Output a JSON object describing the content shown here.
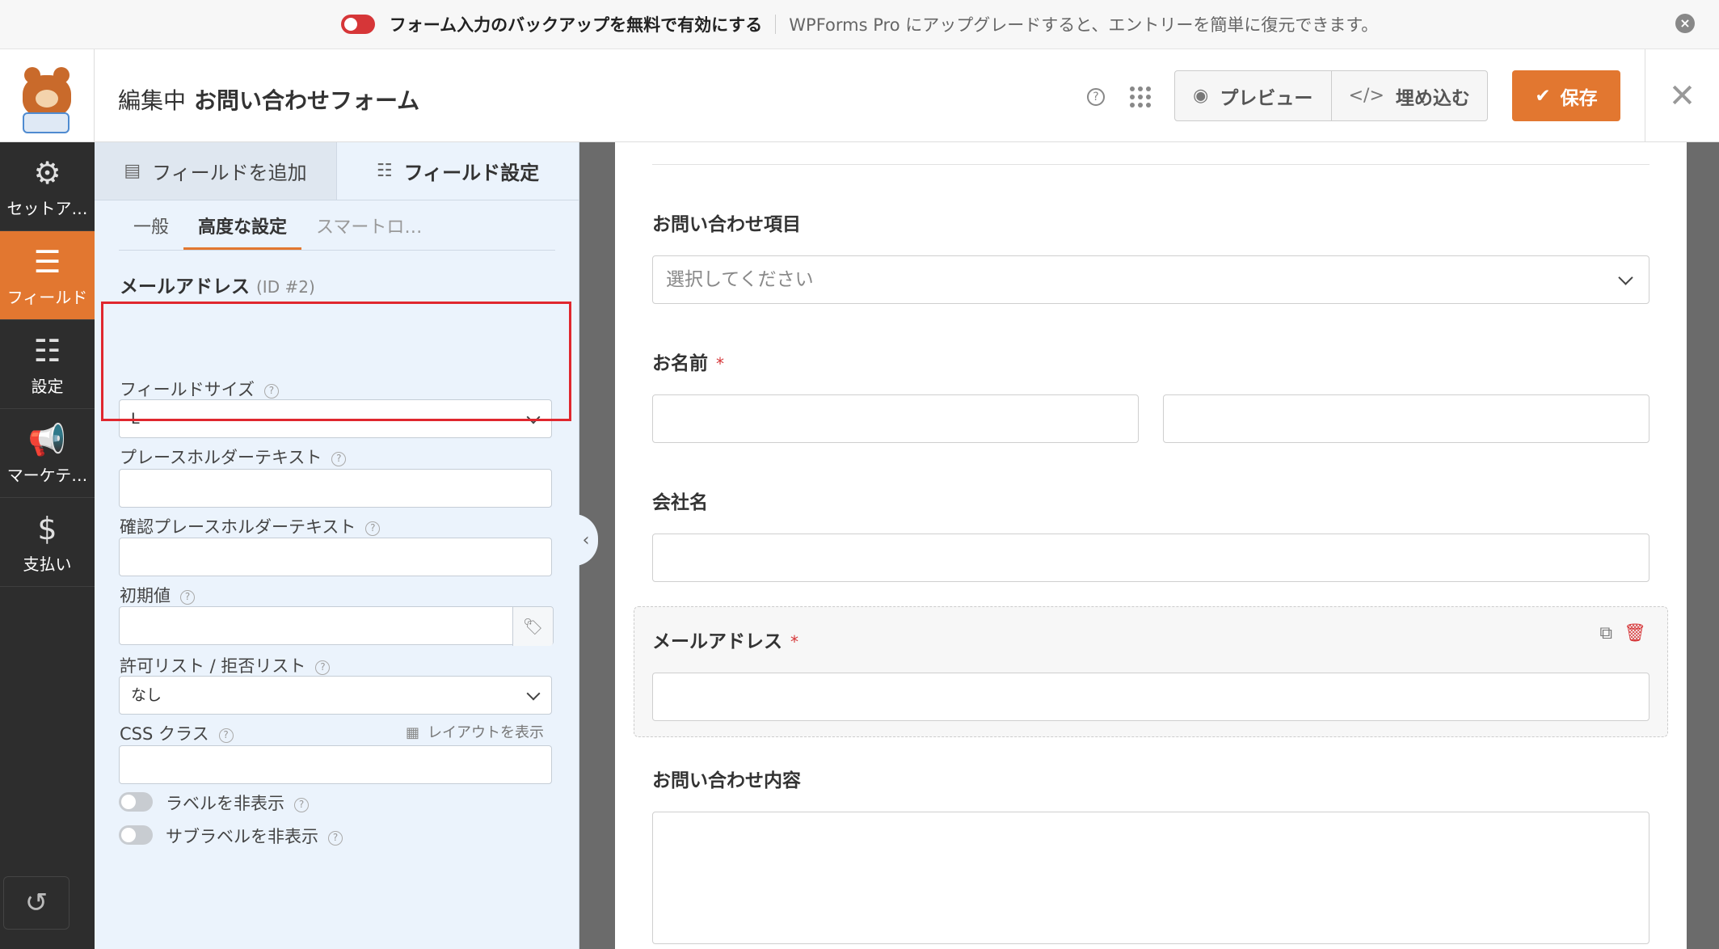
{
  "notice": {
    "main": "フォーム入力のバックアップを無料で有効にする",
    "sub": "WPForms Pro にアップグレードすると、エントリーを簡単に復元できます。"
  },
  "header": {
    "editing_label": "編集中",
    "form_name": "お問い合わせフォーム",
    "preview_label": "プレビュー",
    "embed_label": "埋め込む",
    "save_label": "保存"
  },
  "leftnav": {
    "items": [
      {
        "label": "セットア…",
        "icon": "gear-icon"
      },
      {
        "label": "フィールド",
        "icon": "fields-icon"
      },
      {
        "label": "設定",
        "icon": "sliders-icon"
      },
      {
        "label": "マーケテ…",
        "icon": "megaphone-icon"
      },
      {
        "label": "支払い",
        "icon": "dollar-icon"
      }
    ]
  },
  "panel": {
    "tabs": [
      "フィールドを追加",
      "フィールド設定"
    ],
    "subtabs": [
      "一般",
      "高度な設定",
      "スマートロ…"
    ],
    "field_name": "メールアドレス",
    "field_id": "(ID #2)",
    "field_size_label": "フィールドサイズ",
    "field_size_value": "L",
    "placeholder_label": "プレースホルダーテキスト",
    "placeholder_value": "",
    "confirm_placeholder_label": "確認プレースホルダーテキスト",
    "confirm_placeholder_value": "",
    "default_label": "初期値",
    "default_value": "",
    "allowlist_label": "許可リスト / 拒否リスト",
    "allowlist_value": "なし",
    "css_label": "CSS クラス",
    "css_value": "",
    "layout_link": "レイアウトを表示",
    "hide_label": "ラベルを非表示",
    "hide_sublabel": "サブラベルを非表示"
  },
  "form": {
    "fields": [
      {
        "label": "お問い合わせ項目",
        "placeholder": "選択してください"
      },
      {
        "label": "お名前",
        "required": "*"
      },
      {
        "label": "会社名"
      },
      {
        "label": "メールアドレス",
        "required": "*"
      },
      {
        "label": "お問い合わせ内容"
      }
    ]
  },
  "colors": {
    "accent": "#e27730",
    "sidebar": "#2d2d2d",
    "panel": "#ebf3fc",
    "highlight": "#e0272e",
    "required": "#d63638"
  }
}
